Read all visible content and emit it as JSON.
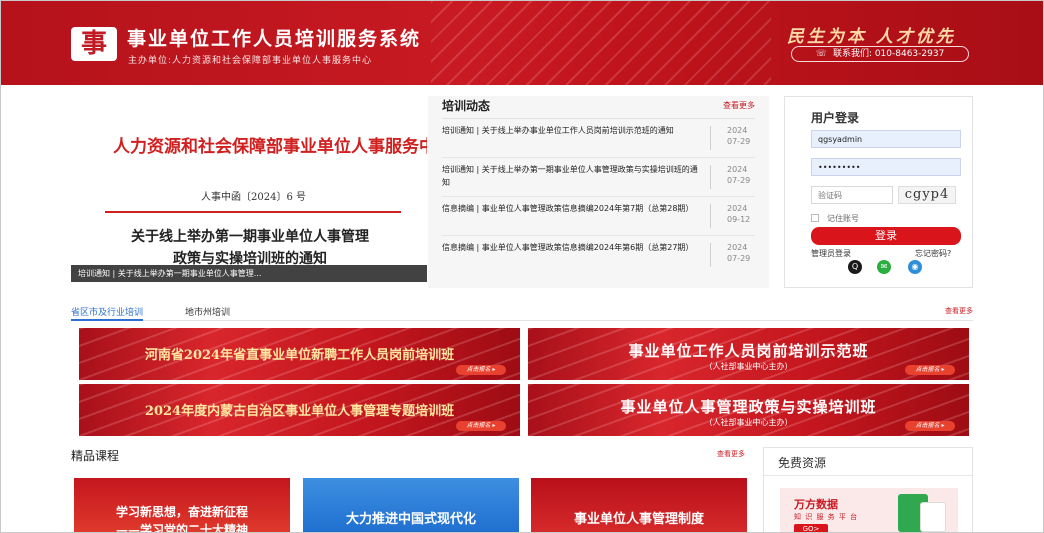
{
  "header": {
    "logo_char": "事",
    "title": "事业单位工作人员培训服务系统",
    "subtitle": "主办单位:人力资源和社会保障部事业单位人事服务中心",
    "slogan": "民生为本 人才优先",
    "hotline": "联系我们: 010-8463-2937"
  },
  "notice_image": {
    "org": "人力资源和社会保障部事业单位人事服务中心",
    "doc_no": "人事中函〔2024〕6 号",
    "title_line1": "关于线上举办第一期事业单位人事管理",
    "title_line2": "政策与实操培训班的通知",
    "caption": "培训通知 | 关于线上举办第一期事业单位人事管理..."
  },
  "news": {
    "title": "培训动态",
    "more": "查看更多",
    "items": [
      {
        "text": "培训通知 | 关于线上举办事业单位工作人员岗前培训示范班的通知",
        "year": "2024",
        "date": "07-29"
      },
      {
        "text": "培训通知 | 关于线上举办第一期事业单位人事管理政策与实操培训班的通知",
        "year": "2024",
        "date": "07-29"
      },
      {
        "text": "信息摘编 | 事业单位人事管理政策信息摘编2024年第7期（总第28期）",
        "year": "2024",
        "date": "09-12"
      },
      {
        "text": "信息摘编 | 事业单位人事管理政策信息摘编2024年第6期（总第27期）",
        "year": "2024",
        "date": "07-29"
      }
    ]
  },
  "login": {
    "title": "用户登录",
    "username_value": "qgsyadmin",
    "password_value": "•••••••••",
    "captcha_placeholder": "验证码",
    "captcha_text": "cgyp4",
    "remember": "记住账号",
    "button": "登录",
    "admin": "管理员登录",
    "forgot": "忘记密码?"
  },
  "tabs": {
    "tab1": "省区市及行业培训",
    "tab2": "地市州培训",
    "more": "查看更多"
  },
  "banners": [
    {
      "title": "河南省2024年省直事业单位新聘工作人员岗前培训班",
      "sub": "",
      "join": "点击报名 ▸"
    },
    {
      "title": "事业单位工作人员岗前培训示范班",
      "sub": "（人社部事业中心主办）",
      "join": "点击报名 ▸"
    },
    {
      "title": "2024年度内蒙古自治区事业单位人事管理专题培训班",
      "sub": "",
      "join": "点击报名 ▸"
    },
    {
      "title": "事业单位人事管理政策与实操培训班",
      "sub": "（人社部事业中心主办）",
      "join": "点击报名 ▸"
    }
  ],
  "courses": {
    "title": "精品课程",
    "more": "查看更多",
    "c1_line1": "学习新思想，奋进新征程",
    "c1_line2": "——学习党的二十大精神",
    "c2": "大力推进中国式现代化",
    "c3": "事业单位人事管理制度"
  },
  "free": {
    "title": "免费资源",
    "ad_name": "万方数据",
    "ad_desc": "知 识 服 务 平 台",
    "ad_go": "GO>"
  },
  "colors": {
    "brand_red": "#c81a22",
    "tab_blue": "#2a6fd1"
  }
}
